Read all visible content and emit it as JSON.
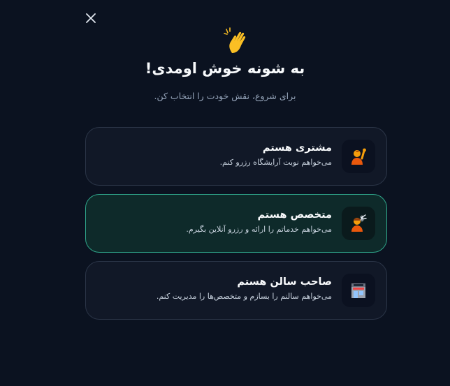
{
  "header": {
    "close_icon": "close-icon",
    "wave_icon": "waving-hand-icon",
    "title": "به شونه خوش اومدی!",
    "subtitle": "برای شروع، نقش خودت را انتخاب کن."
  },
  "roles": [
    {
      "icon": "person-raising-hand-icon",
      "title": "مشتری هستم",
      "description": "می‌خواهم نوبت آرایشگاه رزرو کنم.",
      "selected": false
    },
    {
      "icon": "haircut-person-icon",
      "title": "متخصص هستم",
      "description": "می‌خواهم خدماتم را ارائه و رزرو آنلاین بگیرم.",
      "selected": true
    },
    {
      "icon": "salon-storefront-icon",
      "title": "صاحب سالن هستم",
      "description": "می‌خواهم سالنم را بسازم و متخصص‌ها را مدیریت کنم.",
      "selected": false
    }
  ],
  "colors": {
    "background": "#0b1220",
    "card": "#111827",
    "card_selected": "#0e2a2a",
    "accent_border": "#2fa58a",
    "muted_text": "#94a3b8"
  }
}
